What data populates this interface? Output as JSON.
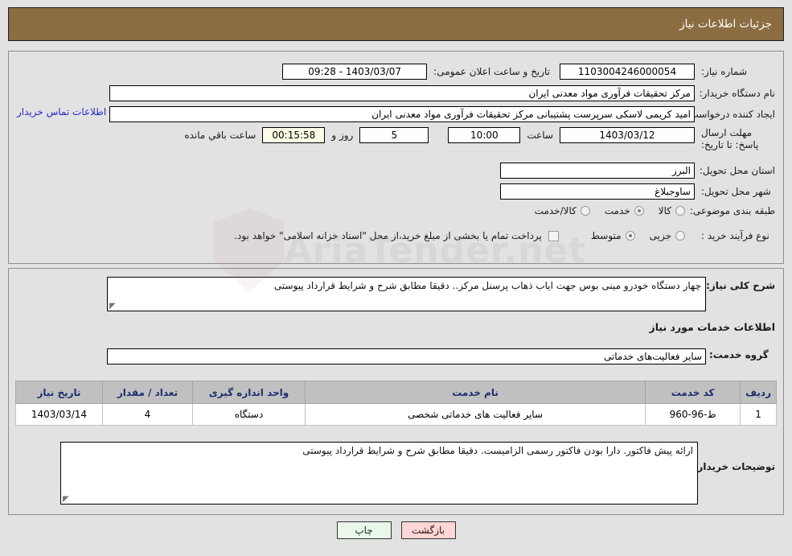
{
  "header": {
    "title": "جزئیات اطلاعات نیاز"
  },
  "top_form": {
    "need_number_label": "شماره نیاز:",
    "need_number_value": "1103004246000054",
    "announce_datetime_label": "تاریخ و ساعت اعلان عمومی:",
    "announce_datetime_value": "1403/03/07 - 09:28",
    "buyer_org_label": "نام دستگاه خریدار:",
    "buyer_org_value": "مرکز تحقیقات فرآوری مواد معدنی ایران",
    "creator_label": "ایجاد کننده درخواست:",
    "creator_value": "امید کریمی لاسکی سرپرست پشتیبانی مرکز تحقیقات فرآوری مواد معدنی ایران",
    "contact_link": "اطلاعات تماس خریدار",
    "deadline_label": "مهلت ارسال پاسخ: تا تاریخ:",
    "deadline_date": "1403/03/12",
    "hour_label": "ساعت",
    "hour_value": "10:00",
    "days_value": "5",
    "days_label": "روز و",
    "remaining_value": "00:15:58",
    "remaining_label": "ساعت باقي مانده",
    "province_label": "استان محل تحویل:",
    "province_value": "البرز",
    "city_label": "شهر محل تحویل:",
    "city_value": "ساوجبلاغ",
    "category_label": "طبقه بندی موضوعی:",
    "category_options": [
      {
        "label": "کالا",
        "selected": false
      },
      {
        "label": "خدمت",
        "selected": true
      },
      {
        "label": "کالا/خدمت",
        "selected": false
      }
    ],
    "process_label": "نوع فرآیند خرید :",
    "process_options": [
      {
        "label": "جزیی",
        "selected": false
      },
      {
        "label": "متوسط",
        "selected": true
      }
    ],
    "treasury_checkbox_label": "پرداخت تمام یا بخشی از مبلغ خرید،از محل \"اسناد خزانه اسلامی\" خواهد بود.",
    "treasury_checked": false
  },
  "middle": {
    "need_desc_label": "شرح کلی نیاز:",
    "need_desc_value": "چهار دستگاه خودرو مینی بوس جهت ایاب ذهاب پرسنل مرکز.. دقیقا مطابق شرح و شرایط قرارداد پیوستی",
    "services_section_title": "اطلاعات خدمات مورد نیاز",
    "service_group_label": "گروه خدمت:",
    "service_group_value": "سایر فعالیت‌های خدماتی"
  },
  "table": {
    "columns": [
      "ردیف",
      "کد خدمت",
      "نام خدمت",
      "واحد اندازه گیری",
      "تعداد / مقدار",
      "تاریخ نیاز"
    ],
    "rows": [
      {
        "index": "1",
        "code": "ط-96-960",
        "name": "سایر فعالیت های خدماتی شخصی",
        "unit": "دستگاه",
        "quantity": "4",
        "date": "1403/03/14"
      }
    ]
  },
  "notes": {
    "label": "توضیحات خریدار:",
    "value": "ارائه پیش فاکتور. دارا بودن فاکتور رسمی الزامیست. دقیقا مطابق شرح و شرایط قرارداد پیوستی"
  },
  "buttons": {
    "print": "چاپ",
    "back": "بازگشت"
  },
  "watermark": {
    "text": "AriaTender.net"
  },
  "colors": {
    "header_brown": "#8c6d42",
    "page_bg": "#e2e2e2",
    "link_blue": "#2626cf",
    "table_header": "#c0c0c0",
    "btn_print": "#eaf7ea",
    "btn_back": "#ffd6d6",
    "cream_field": "#fbfbe8"
  }
}
